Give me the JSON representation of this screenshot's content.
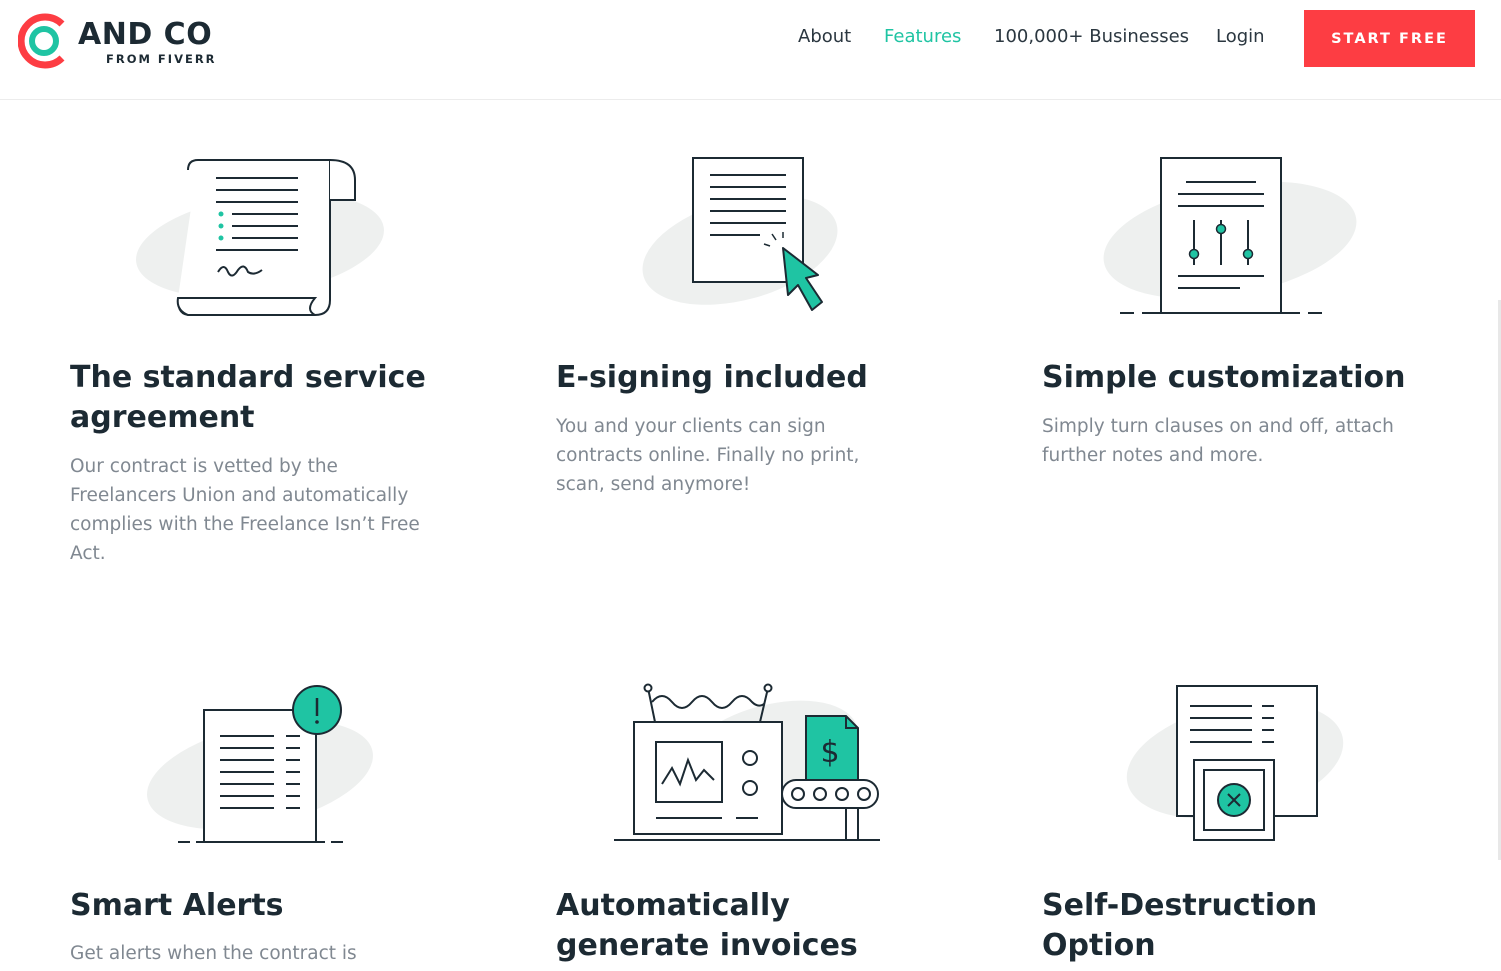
{
  "brand": {
    "name": "AND CO",
    "sub": "FROM FIVERR",
    "colors": {
      "ring_red": "#fd3d43",
      "ring_teal": "#1fc4a3"
    }
  },
  "nav": {
    "about": "About",
    "features": "Features",
    "businesses": "100,000+ Businesses",
    "login": "Login",
    "active_item": "Features",
    "active_color": "#1fc4a3"
  },
  "cta": {
    "label": "START FREE",
    "color": "#fd3d43"
  },
  "features": [
    {
      "icon": "contract-scroll-icon",
      "title_line1": "The standard service",
      "title_line2": "agreement",
      "desc_lines": [
        "Our contract is vetted by the",
        "Freelancers Union and automatically",
        "complies with the Freelance Isn’t Free",
        "Act."
      ]
    },
    {
      "icon": "document-cursor-icon",
      "title_line1": "E-signing included",
      "title_line2": "",
      "desc_lines": [
        "You and your clients can sign",
        "contracts online. Finally no print,",
        "scan, send anymore!"
      ]
    },
    {
      "icon": "document-sliders-icon",
      "title_line1": "Simple customization",
      "title_line2": "",
      "desc_lines": [
        "Simply turn clauses on and off, attach",
        "further notes and more."
      ]
    },
    {
      "icon": "document-alert-icon",
      "title_line1": "Smart Alerts",
      "title_line2": "",
      "desc_lines": [
        "Get alerts when the contract is"
      ]
    },
    {
      "icon": "invoice-machine-icon",
      "title_line1": "Automatically",
      "title_line2": "generate invoices",
      "desc_lines": []
    },
    {
      "icon": "document-destruct-icon",
      "title_line1": "Self-Destruction",
      "title_line2": "Option",
      "desc_lines": []
    }
  ]
}
